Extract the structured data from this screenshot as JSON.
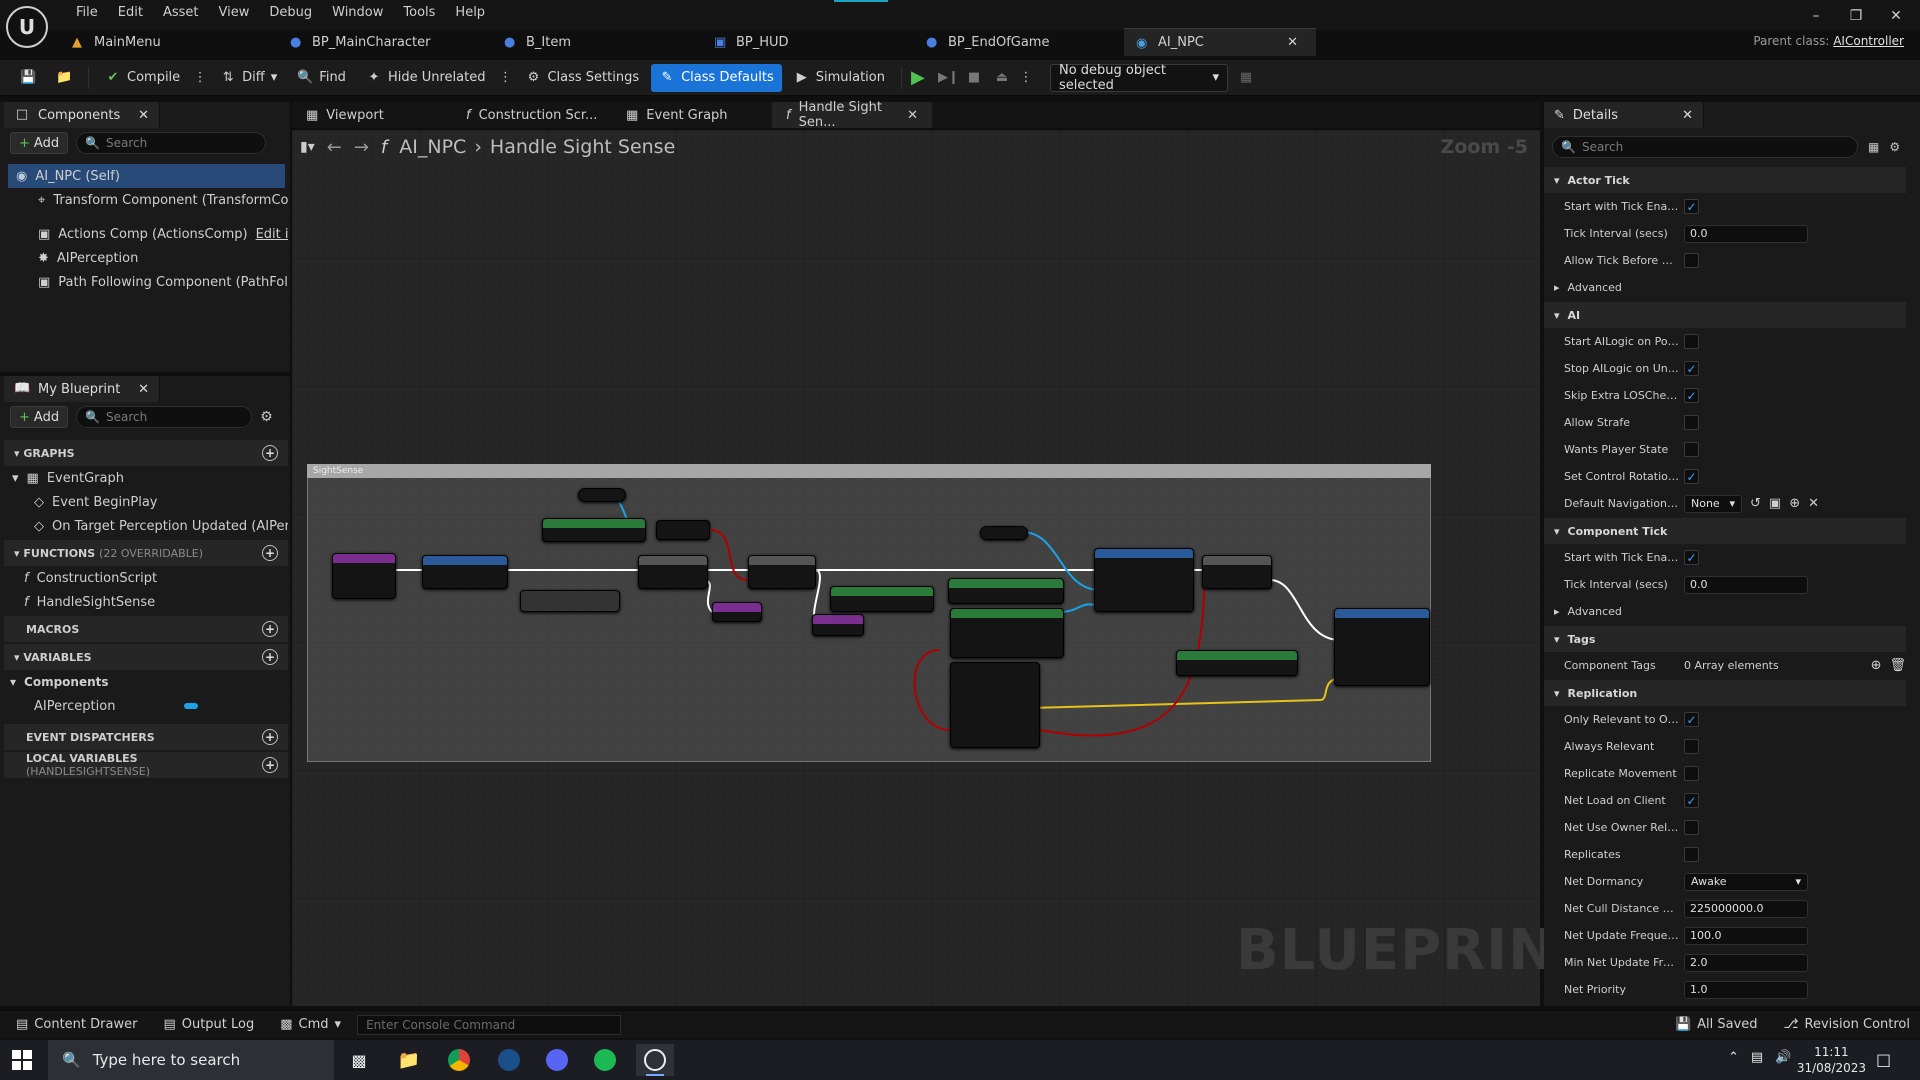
{
  "menu": [
    "File",
    "Edit",
    "Asset",
    "View",
    "Debug",
    "Window",
    "Tools",
    "Help"
  ],
  "doc_tabs": [
    {
      "label": "MainMenu",
      "icon": "level-icon"
    },
    {
      "label": "BP_MainCharacter",
      "icon": "blueprint-icon"
    },
    {
      "label": "B_Item",
      "icon": "blueprint-icon"
    },
    {
      "label": "BP_HUD",
      "icon": "widget-icon"
    },
    {
      "label": "BP_EndOfGame",
      "icon": "blueprint-icon"
    },
    {
      "label": "AI_NPC",
      "icon": "ai-icon",
      "active": true
    }
  ],
  "parent_class": {
    "label": "Parent class:",
    "value": "AIController"
  },
  "toolbar": {
    "compile": "Compile",
    "diff": "Diff",
    "find": "Find",
    "hide_unrelated": "Hide Unrelated",
    "class_settings": "Class Settings",
    "class_defaults": "Class Defaults",
    "simulation": "Simulation",
    "debug_object": "No debug object selected"
  },
  "components_panel": {
    "title": "Components",
    "add": "Add",
    "search_placeholder": "Search",
    "items": [
      {
        "label": "AI_NPC (Self)",
        "selected": true
      },
      {
        "label": "Transform Component (TransformComp"
      },
      {
        "label": "Actions Comp (ActionsComp)",
        "link": "Edit in C+"
      },
      {
        "label": "AIPerception"
      },
      {
        "label": "Path Following Component (PathFollowi"
      }
    ]
  },
  "my_blueprint": {
    "title": "My Blueprint",
    "add": "Add",
    "search_placeholder": "Search",
    "graphs_header": "GRAPHS",
    "event_graph": "EventGraph",
    "events": [
      "Event BeginPlay",
      "On Target Perception Updated (AIPercep"
    ],
    "functions_header": "FUNCTIONS",
    "functions_sub": "(22 OVERRIDABLE)",
    "functions": [
      "ConstructionScript",
      "HandleSightSense"
    ],
    "macros_header": "MACROS",
    "variables_header": "VARIABLES",
    "components_group": "Components",
    "variables": [
      "AIPerception"
    ],
    "dispatchers_header": "EVENT DISPATCHERS",
    "local_vars_header": "LOCAL VARIABLES",
    "local_vars_sub": "(HANDLESIGHTSENSE)"
  },
  "graph_tabs": [
    "Viewport",
    "Construction Scr...",
    "Event Graph",
    "Handle Sight Sen..."
  ],
  "breadcrumb": {
    "root": "AI_NPC",
    "current": "Handle Sight Sense"
  },
  "zoom": "Zoom -5",
  "watermark": "BLUEPRINT",
  "comment_title": "SightSense",
  "details": {
    "title": "Details",
    "search_placeholder": "Search",
    "categories": [
      {
        "name": "Actor Tick",
        "props": [
          {
            "label": "Start with Tick Enabled",
            "type": "check",
            "value": true
          },
          {
            "label": "Tick Interval (secs)",
            "type": "num",
            "value": "0.0"
          },
          {
            "label": "Allow Tick Before Begi...",
            "type": "check",
            "value": false
          }
        ],
        "advanced": "Advanced"
      },
      {
        "name": "AI",
        "props": [
          {
            "label": "Start AILogic on Poss...",
            "type": "check",
            "value": false
          },
          {
            "label": "Stop AILogic on Unpos...",
            "type": "check",
            "value": true
          },
          {
            "label": "Skip Extra LOSChecks",
            "type": "check",
            "value": true
          },
          {
            "label": "Allow Strafe",
            "type": "check",
            "value": false
          },
          {
            "label": "Wants Player State",
            "type": "check",
            "value": false
          },
          {
            "label": "Set Control Rotation fr...",
            "type": "check",
            "value": true
          },
          {
            "label": "Default Navigation Filt...",
            "type": "drop",
            "value": "None"
          }
        ]
      },
      {
        "name": "Component Tick",
        "props": [
          {
            "label": "Start with Tick Enabled",
            "type": "check",
            "value": true
          },
          {
            "label": "Tick Interval (secs)",
            "type": "num",
            "value": "0.0"
          }
        ],
        "advanced": "Advanced"
      },
      {
        "name": "Tags",
        "props": [
          {
            "label": "Component Tags",
            "type": "text",
            "value": "0 Array elements"
          }
        ]
      },
      {
        "name": "Replication",
        "props": [
          {
            "label": "Only Relevant to Owner",
            "type": "check",
            "value": true
          },
          {
            "label": "Always Relevant",
            "type": "check",
            "value": false
          },
          {
            "label": "Replicate Movement",
            "type": "check",
            "value": false
          },
          {
            "label": "Net Load on Client",
            "type": "check",
            "value": true
          },
          {
            "label": "Net Use Owner Releva...",
            "type": "check",
            "value": false
          },
          {
            "label": "Replicates",
            "type": "check",
            "value": false
          },
          {
            "label": "Net Dormancy",
            "type": "drop",
            "value": "Awake"
          },
          {
            "label": "Net Cull Distance Squ...",
            "type": "num",
            "value": "225000000.0"
          },
          {
            "label": "Net Update Frequency",
            "type": "num",
            "value": "100.0"
          },
          {
            "label": "Min Net Update Frequ...",
            "type": "num",
            "value": "2.0"
          },
          {
            "label": "Net Priority",
            "type": "num",
            "value": "1.0"
          }
        ]
      }
    ]
  },
  "statusbar": {
    "content_drawer": "Content Drawer",
    "output_log": "Output Log",
    "cmd": "Cmd",
    "console_placeholder": "Enter Console Command",
    "all_saved": "All Saved",
    "revision_control": "Revision Control"
  },
  "taskbar": {
    "search_placeholder": "Type here to search",
    "time": "11:11",
    "date": "31/08/2023"
  },
  "colors": {
    "accent": "#1a74d8",
    "check": "#3aa3ff",
    "exec_wire": "#ffffff",
    "bool_wire": "#b00000",
    "object_wire": "#1aa3e6",
    "vector_wire": "#e6c21a"
  }
}
